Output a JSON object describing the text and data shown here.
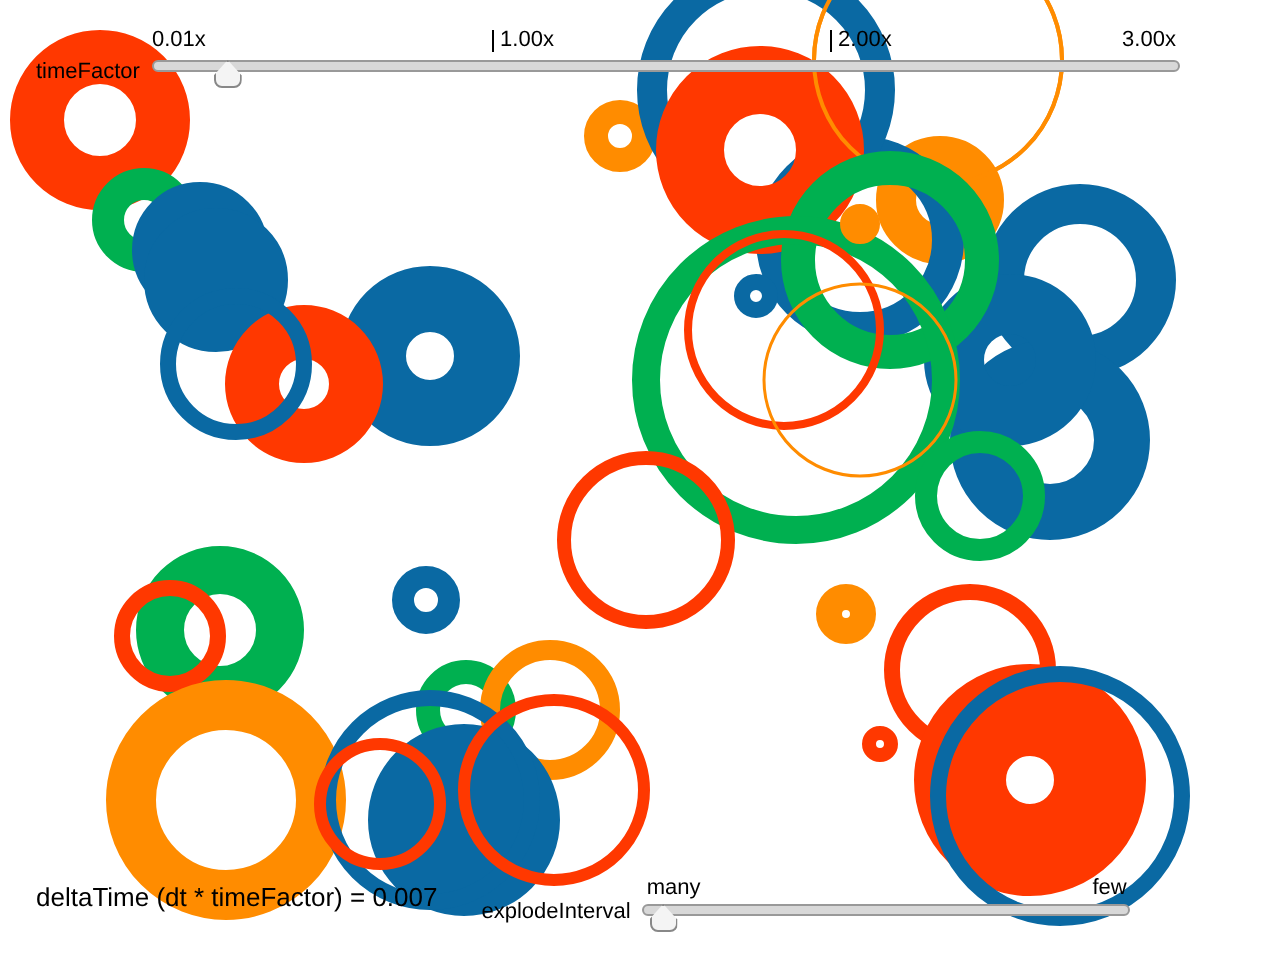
{
  "time_slider": {
    "label": "timeFactor",
    "ticks": [
      "0.01x",
      "1.00x",
      "2.00x",
      "3.00x"
    ],
    "level": 0.06
  },
  "status": {
    "text": "deltaTime (dt * timeFactor) = 0.007"
  },
  "explode_slider": {
    "label": "explodeInterval",
    "min_label": "many",
    "max_label": "few",
    "level": 0.01
  }
}
